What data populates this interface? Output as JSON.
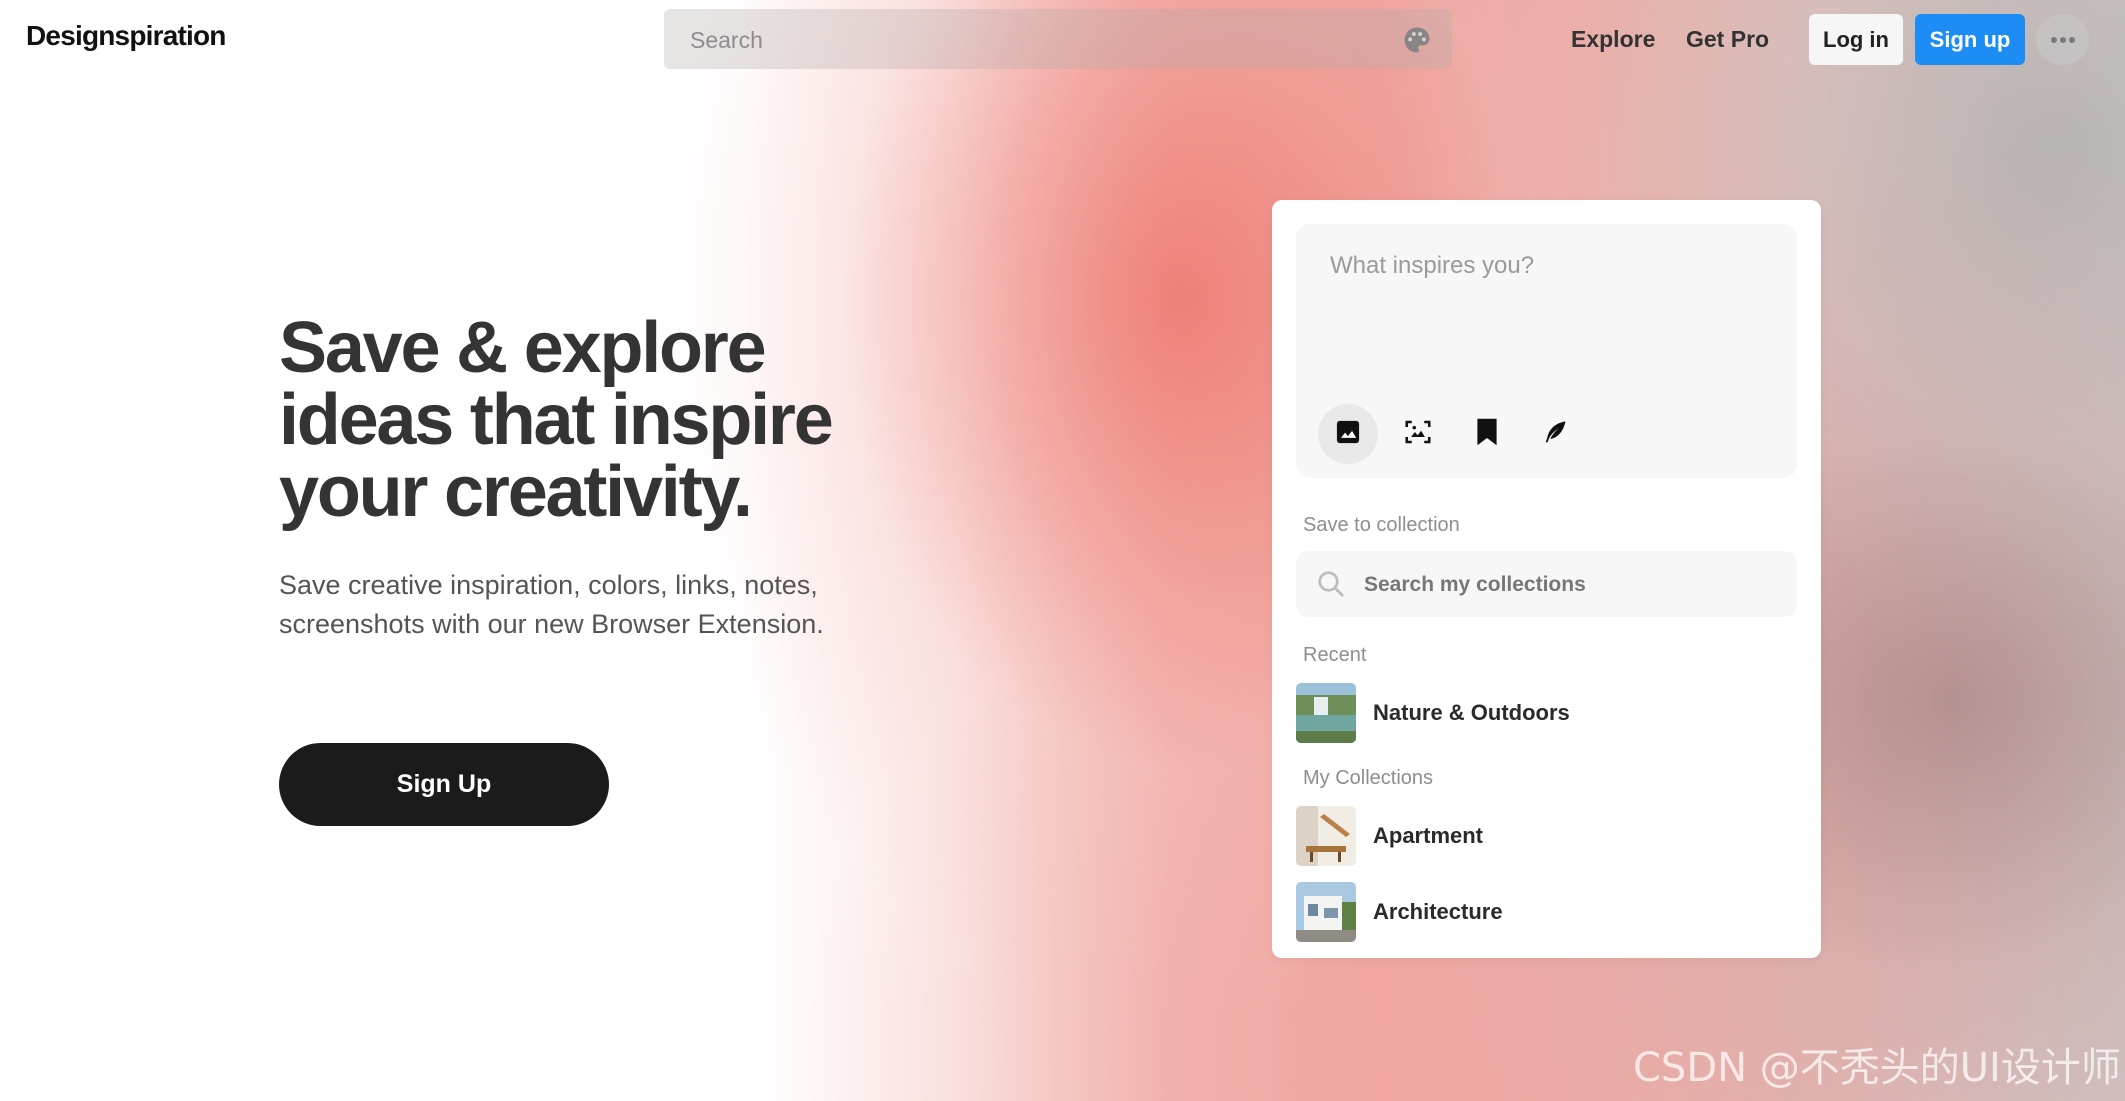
{
  "header": {
    "logo": "Designspiration",
    "search_placeholder": "Search",
    "nav": {
      "explore": "Explore",
      "get_pro": "Get Pro",
      "log_in": "Log in",
      "sign_up": "Sign up"
    }
  },
  "hero": {
    "title_lines": [
      "Save & explore",
      "ideas that inspire",
      "your creativity."
    ],
    "subtitle_lines": [
      "Save creative inspiration, colors, links, notes,",
      "screenshots with our new Browser Extension."
    ],
    "cta": "Sign Up"
  },
  "save_card": {
    "prompt_placeholder": "What inspires you?",
    "tools": [
      "image-icon",
      "screenshot-icon",
      "bookmark-icon",
      "quill-icon"
    ],
    "active_tool": "image-icon",
    "save_to_collection_label": "Save to collection",
    "collections_search_placeholder": "Search my collections",
    "recent_label": "Recent",
    "recent": [
      {
        "name": "Nature & Outdoors"
      }
    ],
    "my_collections_label": "My Collections",
    "collections": [
      {
        "name": "Apartment"
      },
      {
        "name": "Architecture"
      }
    ]
  },
  "watermark": "CSDN @不秃头的UI设计师",
  "colors": {
    "primary_blue": "#1e8cf5",
    "cta_dark": "#1b1b1b",
    "title_text": "#343434",
    "accent_coral": "#ec7870"
  }
}
